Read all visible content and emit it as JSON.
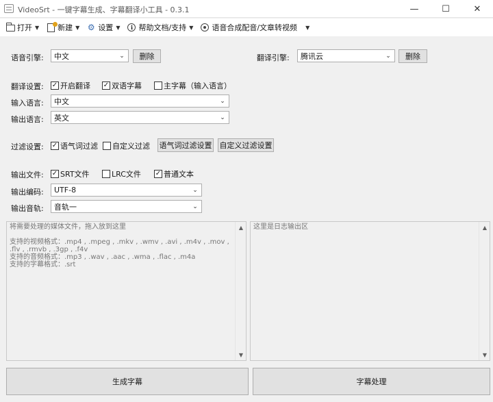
{
  "window": {
    "title": "VideoSrt - 一键字幕生成、字幕翻译小工具 - 0.3.1",
    "minimize_glyph": "—",
    "maximize_glyph": "☐",
    "close_glyph": "✕"
  },
  "menu": {
    "open": "打开",
    "new": "新建",
    "settings": "设置",
    "help": "帮助文档/支持",
    "tts": "语音合成配音/文章转视频",
    "caret": "▼"
  },
  "speech": {
    "label": "语音引擎:",
    "value": "中文",
    "delete": "删除"
  },
  "translate_engine": {
    "label": "翻译引擎:",
    "value": "腾讯云",
    "delete": "删除"
  },
  "translate": {
    "label": "翻译设置:",
    "enable": {
      "label": "开启翻译",
      "checked": true
    },
    "bilingual": {
      "label": "双语字幕",
      "checked": true
    },
    "main_sub": {
      "label": "主字幕（输入语言）",
      "checked": false
    },
    "input_label": "输入语言:",
    "input_value": "中文",
    "output_label": "输出语言:",
    "output_value": "英文"
  },
  "filter": {
    "label": "过滤设置:",
    "modal": {
      "label": "语气词过滤",
      "checked": true
    },
    "custom": {
      "label": "自定义过滤",
      "checked": false
    },
    "modal_btn": "语气词过滤设置",
    "custom_btn": "自定义过滤设置"
  },
  "output": {
    "label": "输出文件:",
    "srt": {
      "label": "SRT文件",
      "checked": true
    },
    "lrc": {
      "label": "LRC文件",
      "checked": false
    },
    "txt": {
      "label": "普通文本",
      "checked": true
    },
    "encoding_label": "输出编码:",
    "encoding_value": "UTF-8",
    "track_label": "输出音轨:",
    "track_value": "音轨一"
  },
  "media_panel": {
    "text": "将需要处理的媒体文件，拖入放到这里\n\n支持的视频格式：.mp4 , .mpeg , .mkv , .wmv , .avi , .m4v , .mov , .flv , .rmvb , .3gp , .f4v\n支持的音频格式：.mp3 , .wav , .aac , .wma , .flac , .m4a\n支持的字幕格式：.srt"
  },
  "log_panel": {
    "text": "这里是日志输出区"
  },
  "actions": {
    "generate": "生成字幕",
    "process": "字幕处理"
  },
  "glyphs": {
    "check": "✓",
    "combo_arrow": "⌄",
    "up": "▲",
    "down": "▼"
  }
}
